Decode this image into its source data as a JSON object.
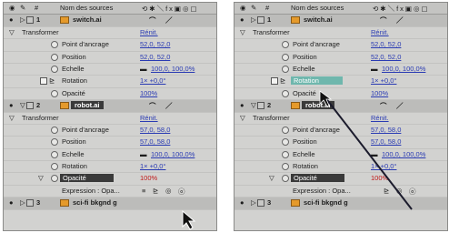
{
  "header": {
    "hash": "#",
    "source_name": "Nom des sources"
  },
  "panelA": {
    "layer1": {
      "num": "1",
      "name": "switch.ai"
    },
    "transform": {
      "label": "Transformer",
      "reset": "Rénit."
    },
    "props1": [
      {
        "label": "Point d'ancrage",
        "value": "52,0, 52,0"
      },
      {
        "label": "Position",
        "value": "52,0, 52,0"
      },
      {
        "label": "Echelle",
        "value": "100,0, 100,0%"
      },
      {
        "label": "Rotation",
        "value": "1× +0,0°"
      },
      {
        "label": "Opacité",
        "value": "100%"
      }
    ],
    "layer2": {
      "num": "2",
      "name": "robot.ai"
    },
    "transform2": {
      "label": "Transformer",
      "reset": "Rénit."
    },
    "props2": [
      {
        "label": "Point d'ancrage",
        "value": "57,0, 58,0"
      },
      {
        "label": "Position",
        "value": "57,0, 58,0"
      },
      {
        "label": "Echelle",
        "value": "100,0, 100,0%"
      },
      {
        "label": "Rotation",
        "value": "1× +0,0°"
      },
      {
        "label": "Opacité",
        "value": "100%"
      }
    ],
    "expression": "Expression : Opa...",
    "layer3": {
      "num": "3",
      "name": "sci-fi bkgnd g"
    }
  },
  "panelB": {
    "layer1": {
      "num": "1",
      "name": "switch.ai"
    },
    "transform": {
      "label": "Transformer",
      "reset": "Rénit."
    },
    "props1": [
      {
        "label": "Point d'ancrage",
        "value": "52,0, 52,0"
      },
      {
        "label": "Position",
        "value": "52,0, 52,0"
      },
      {
        "label": "Echelle",
        "value": "100,0, 100,0%"
      },
      {
        "label": "Rotation",
        "value": "1× +0,0°"
      },
      {
        "label": "Opacité",
        "value": "100%"
      }
    ],
    "layer2": {
      "num": "2",
      "name": "robot.ai"
    },
    "transform2": {
      "label": "Transformer",
      "reset": "Rénit."
    },
    "props2": [
      {
        "label": "Point d'ancrage",
        "value": "57,0, 58,0"
      },
      {
        "label": "Position",
        "value": "57,0, 58,0"
      },
      {
        "label": "Echelle",
        "value": "100,0, 100,0%"
      },
      {
        "label": "Rotation",
        "value": "1× +0,0°"
      },
      {
        "label": "Opacité",
        "value": "100%"
      }
    ],
    "expression": "Expression : Opa...",
    "layer3": {
      "num": "3",
      "name": "sci-fi bkgnd g"
    }
  },
  "colors": {
    "value_link": "#2a3bb3",
    "value_red": "#c01818",
    "ai_file": "#e59a2b",
    "teal_highlight": "#6fb7ad"
  }
}
